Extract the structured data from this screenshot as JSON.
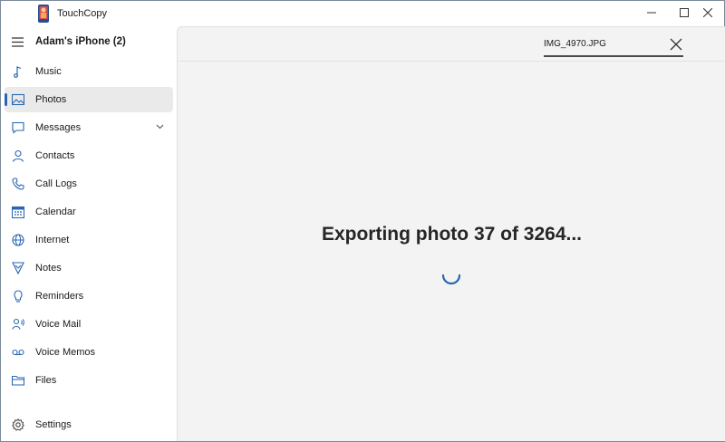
{
  "app": {
    "title": "TouchCopy"
  },
  "sidebar": {
    "device_name": "Adam's iPhone (2)",
    "items": [
      {
        "id": "music",
        "label": "Music",
        "icon": "music-note-icon"
      },
      {
        "id": "photos",
        "label": "Photos",
        "icon": "image-icon",
        "active": true
      },
      {
        "id": "messages",
        "label": "Messages",
        "icon": "message-icon",
        "expandable": true
      },
      {
        "id": "contacts",
        "label": "Contacts",
        "icon": "person-icon"
      },
      {
        "id": "call-logs",
        "label": "Call Logs",
        "icon": "phone-icon"
      },
      {
        "id": "calendar",
        "label": "Calendar",
        "icon": "calendar-icon"
      },
      {
        "id": "internet",
        "label": "Internet",
        "icon": "globe-icon"
      },
      {
        "id": "notes",
        "label": "Notes",
        "icon": "notes-icon"
      },
      {
        "id": "reminders",
        "label": "Reminders",
        "icon": "lightbulb-icon"
      },
      {
        "id": "voice-mail",
        "label": "Voice Mail",
        "icon": "voicemail-headset-icon"
      },
      {
        "id": "voice-memos",
        "label": "Voice Memos",
        "icon": "voice-memo-icon"
      },
      {
        "id": "files",
        "label": "Files",
        "icon": "folder-icon"
      }
    ],
    "settings_label": "Settings"
  },
  "main": {
    "file_name": "IMG_4970.JPG",
    "status": "Exporting photo 37 of 3264..."
  },
  "colors": {
    "accent": "#2866b0",
    "pane_bg": "#f3f3f3"
  }
}
